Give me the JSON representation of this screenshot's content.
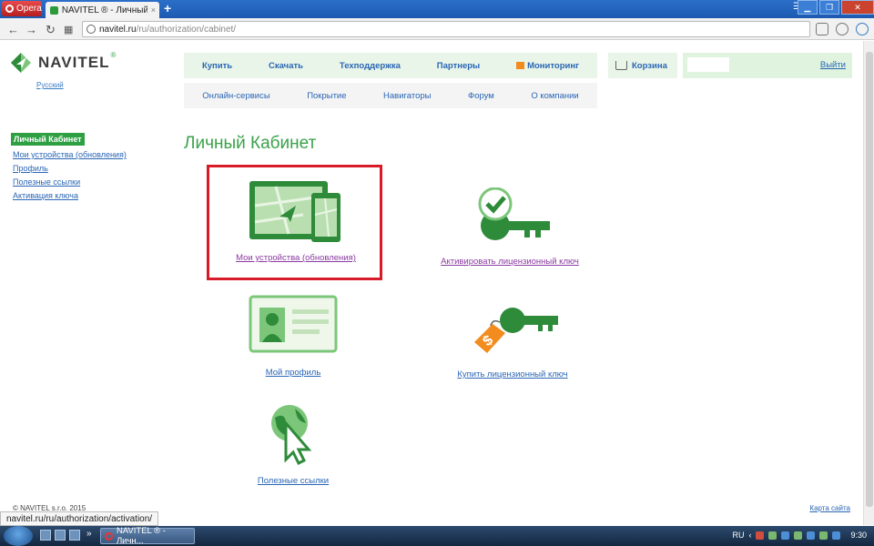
{
  "browser": {
    "menu_label": "Opera",
    "tab_title": "NAVITEL ® - Личный Кабинет",
    "tab_close": "×",
    "new_tab": "+",
    "url_host": "navitel.ru",
    "url_path": "/ru/authorization/cabinet/",
    "status_url": "navitel.ru/ru/authorization/activation/"
  },
  "header": {
    "brand": "NAVITEL",
    "trademark": "®",
    "language": "Русский",
    "nav_primary": [
      "Купить",
      "Скачать",
      "Техподдержка",
      "Партнеры"
    ],
    "monitoring": "Мониторинг",
    "cart": "Корзина",
    "logout": "Выйти",
    "nav_secondary": [
      "Онлайн-сервисы",
      "Покрытие",
      "Навигаторы",
      "Форум",
      "О компании"
    ]
  },
  "sidebar": {
    "active": "Личный Кабинет",
    "items": [
      "Мои устройства (обновления)",
      "Профиль",
      "Полезные ссылки",
      "Активация ключа"
    ]
  },
  "main": {
    "title": "Личный Кабинет",
    "cards": {
      "devices": "Мои устройства (обновления)",
      "activate": "Активировать лицензионный ключ",
      "profile": "Мой профиль",
      "buy": "Купить лицензионный ключ",
      "links": "Полезные ссылки"
    }
  },
  "footer": {
    "copyright": "© NAVITEL s.r.o. 2015",
    "sitemap": "Карта сайта"
  },
  "taskbar": {
    "task": "NAVITEL ® - Личн...",
    "lang": "RU",
    "time": "9:30",
    "more": "»"
  },
  "colors": {
    "brand_green": "#2ea043",
    "link_blue": "#2a66b5",
    "visited_purple": "#8a3aa0",
    "highlight_red": "#d81b28",
    "tag_orange": "#f28c1e"
  }
}
